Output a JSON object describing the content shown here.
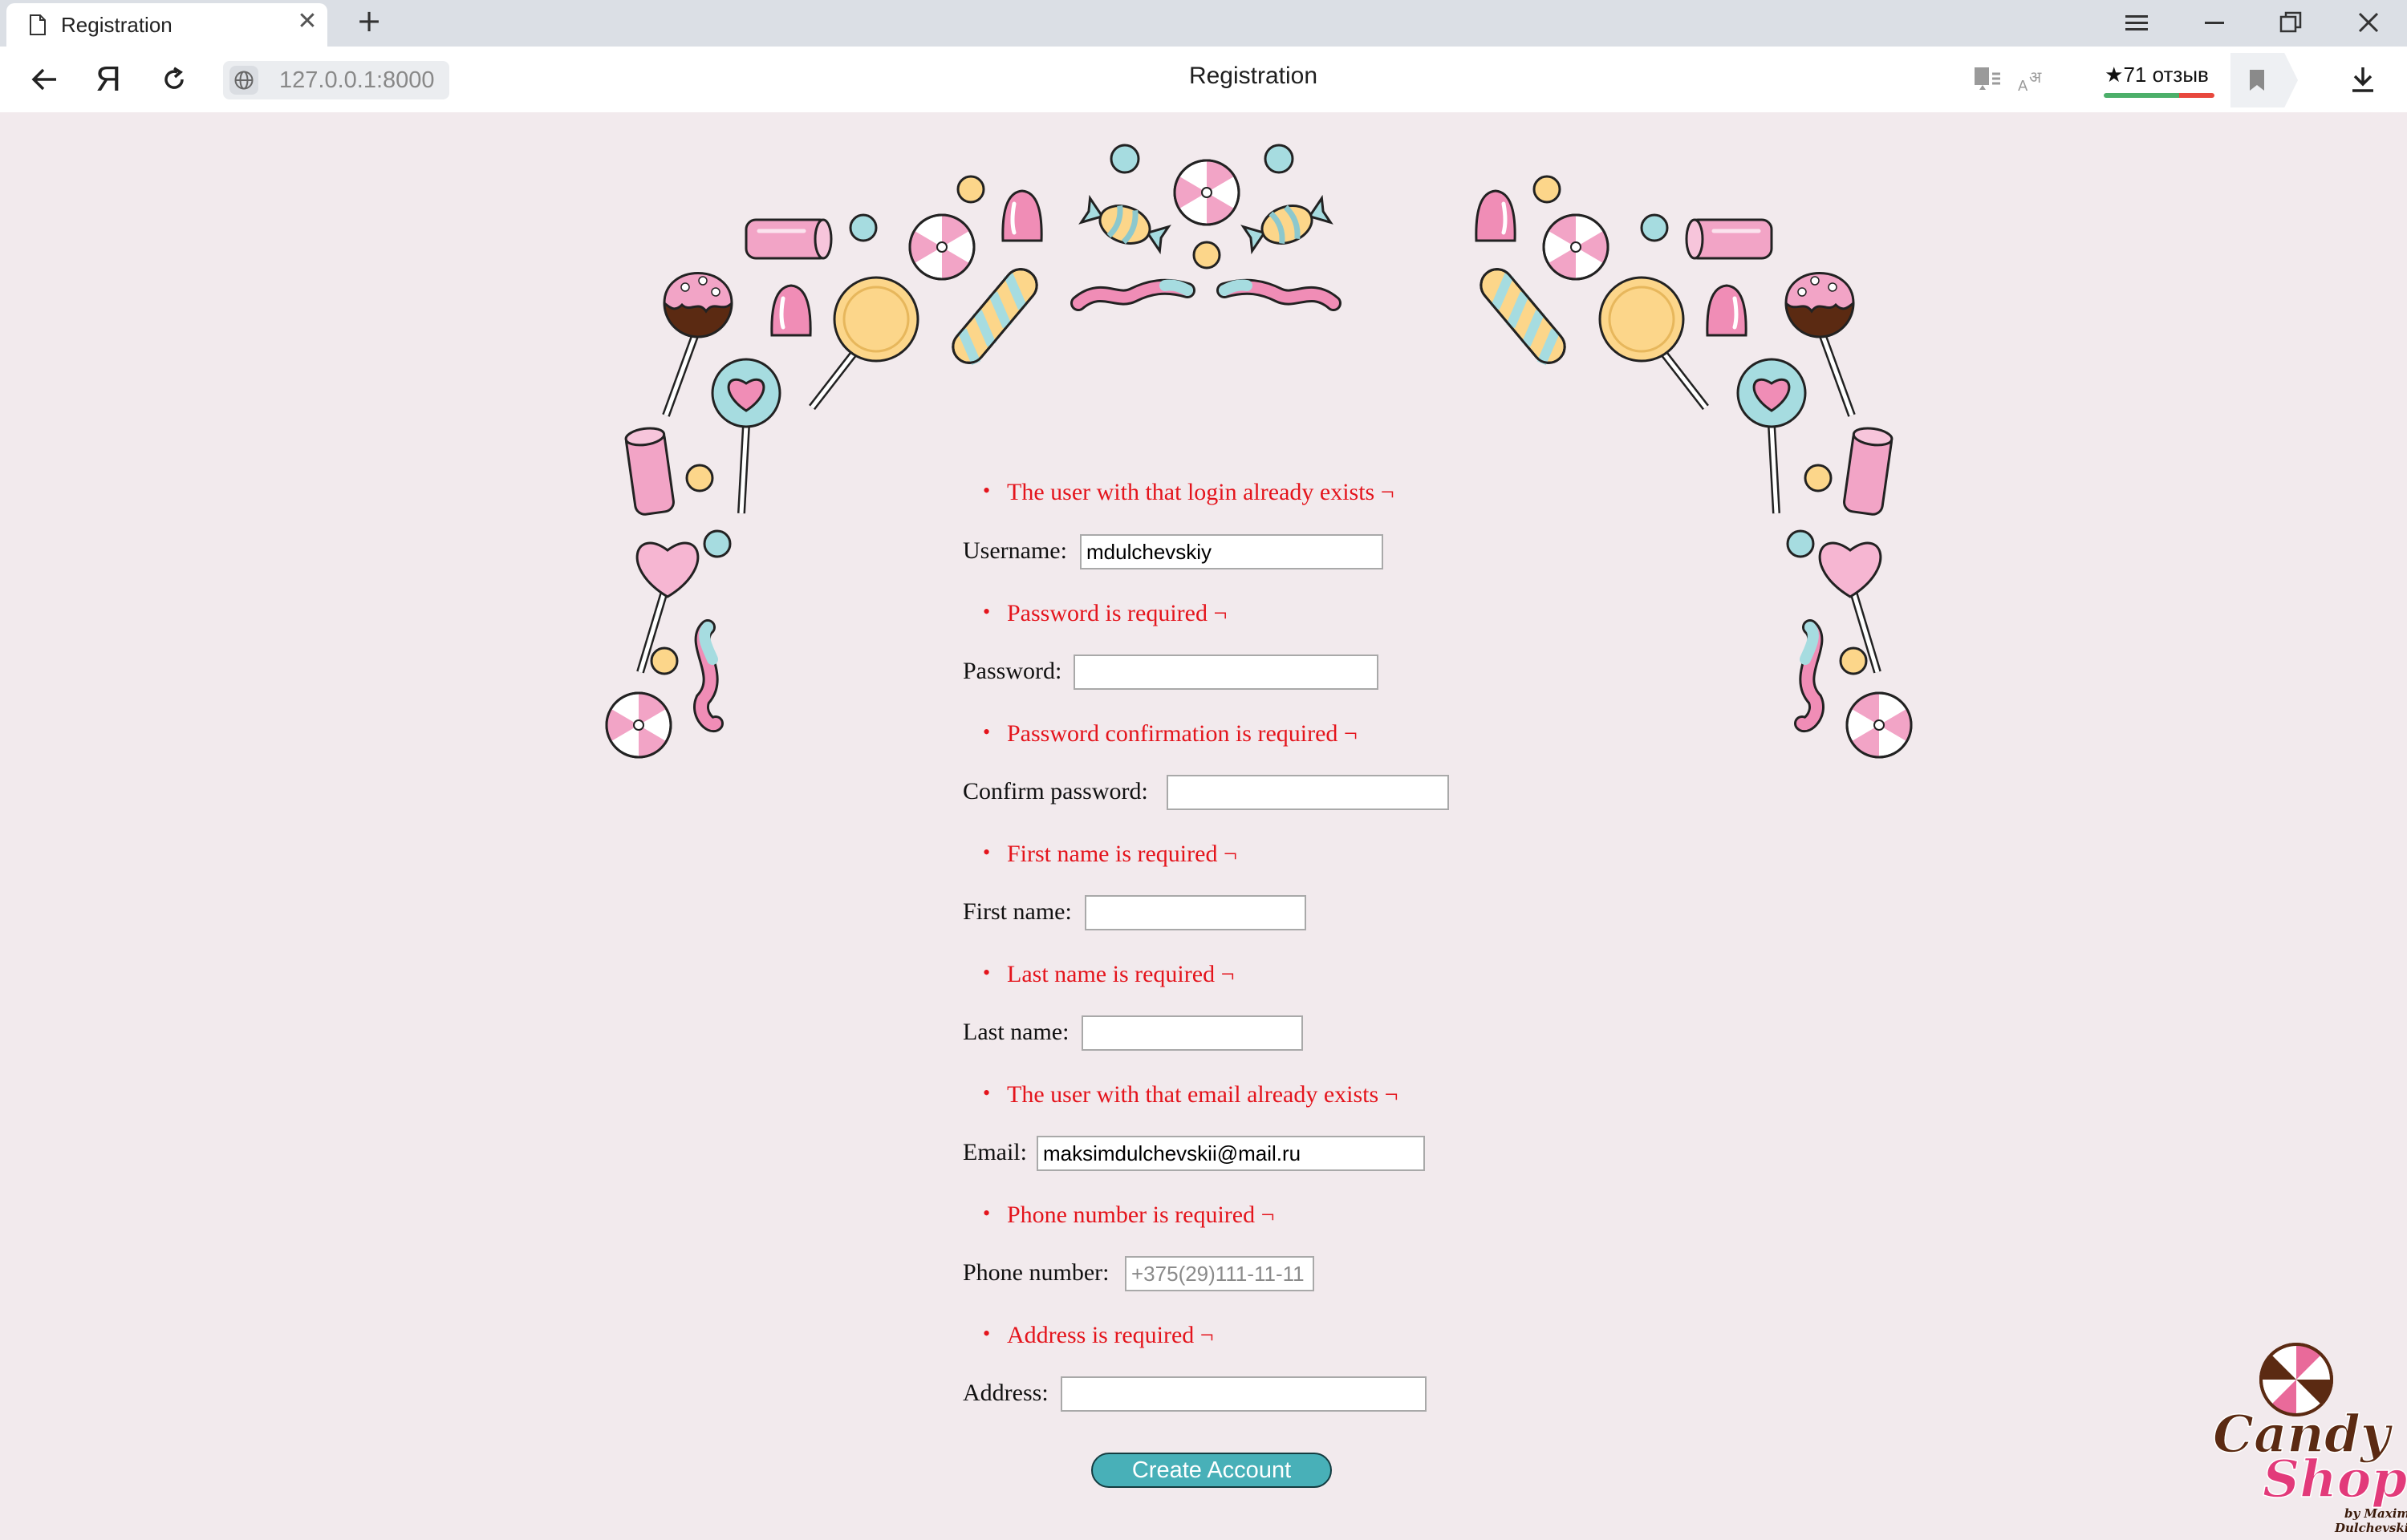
{
  "browser": {
    "tab_title": "Registration",
    "tab_close": "✕",
    "new_tab": "+",
    "url": "127.0.0.1:8000",
    "page_title": "Registration",
    "reviews": "★71 отзыв"
  },
  "colors": {
    "page_bg": "#f2eaed",
    "error": "#e4141c",
    "button": "#48b0b8",
    "candy_pink": "#f2a4c6",
    "candy_blue": "#a6dce0",
    "candy_yellow": "#fcd68a"
  },
  "form": {
    "username": {
      "error": "The user with that login already exists ¬",
      "label": "Username:",
      "value": "mdulchevskiy"
    },
    "password": {
      "error": "Password is required ¬",
      "label": "Password:",
      "value": ""
    },
    "confirm_password": {
      "error": "Password confirmation is required ¬",
      "label": "Confirm password:",
      "value": ""
    },
    "first_name": {
      "error": "First name is required ¬",
      "label": "First name:",
      "value": ""
    },
    "last_name": {
      "error": "Last name is required ¬",
      "label": "Last name:",
      "value": ""
    },
    "email": {
      "error": "The user with that email already exists ¬",
      "label": "Email:",
      "value": "maksimdulchevskii@mail.ru"
    },
    "phone": {
      "error": "Phone number is required ¬",
      "label": "Phone number:",
      "value": "",
      "placeholder": "+375(29)111-11-11"
    },
    "address": {
      "error": "Address is required ¬",
      "label": "Address:",
      "value": ""
    },
    "submit_label": "Create Account"
  },
  "logo": {
    "line1": "Candy",
    "line2": "Shop",
    "byline1": "by Maxim",
    "byline2": "Dulchevskiy"
  }
}
